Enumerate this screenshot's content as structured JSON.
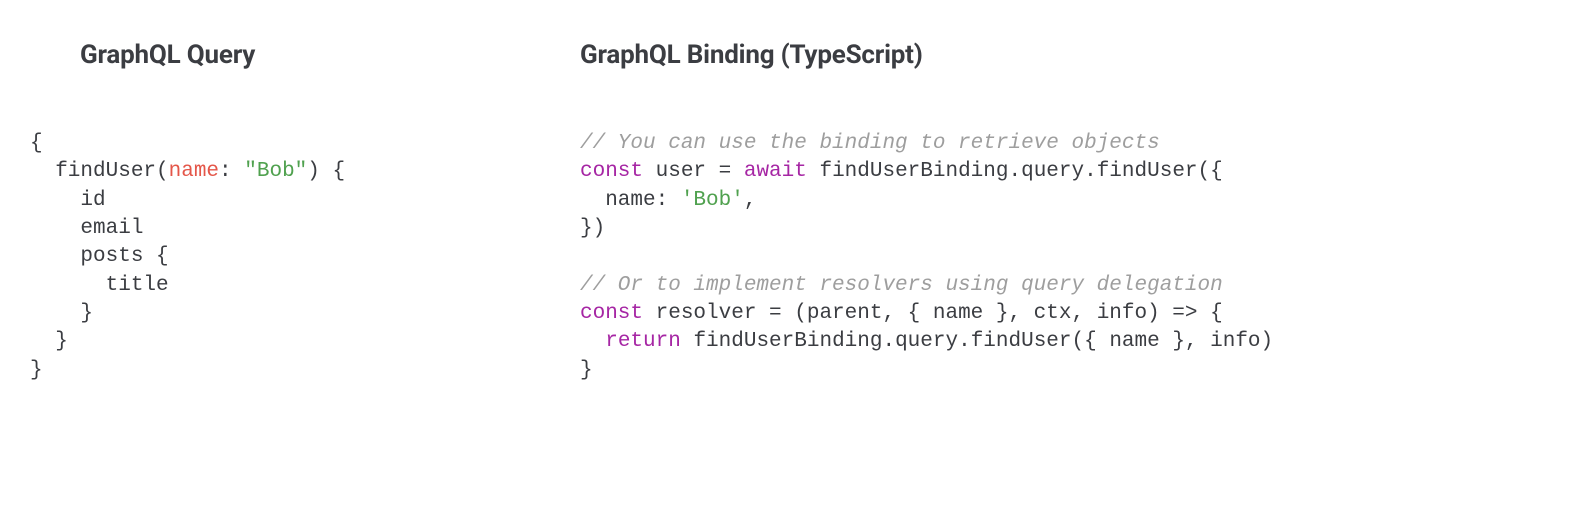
{
  "left": {
    "heading": "GraphQL Query",
    "code": {
      "l1": "{",
      "l2a": "  findUser(",
      "l2b": "name",
      "l2c": ": ",
      "l2d": "\"Bob\"",
      "l2e": ") {",
      "l3": "    id",
      "l4": "    email",
      "l5": "    posts {",
      "l6": "      title",
      "l7": "    }",
      "l8": "  }",
      "l9": "}"
    }
  },
  "right": {
    "heading": "GraphQL Binding (TypeScript)",
    "code": {
      "c1": "// You can use the binding to retrieve objects",
      "l1a": "const",
      "l1b": " user = ",
      "l1c": "await",
      "l1d": " findUserBinding.query.findUser({",
      "l2a": "  name: ",
      "l2b": "'Bob'",
      "l2c": ",",
      "l3": "})",
      "blank": "",
      "c2": "// Or to implement resolvers using query delegation",
      "l4a": "const",
      "l4b": " resolver = (parent, { name }, ctx, info) => {",
      "l5a": "  ",
      "l5b": "return",
      "l5c": " findUserBinding.query.findUser({ name }, info)",
      "l6": "}"
    }
  }
}
